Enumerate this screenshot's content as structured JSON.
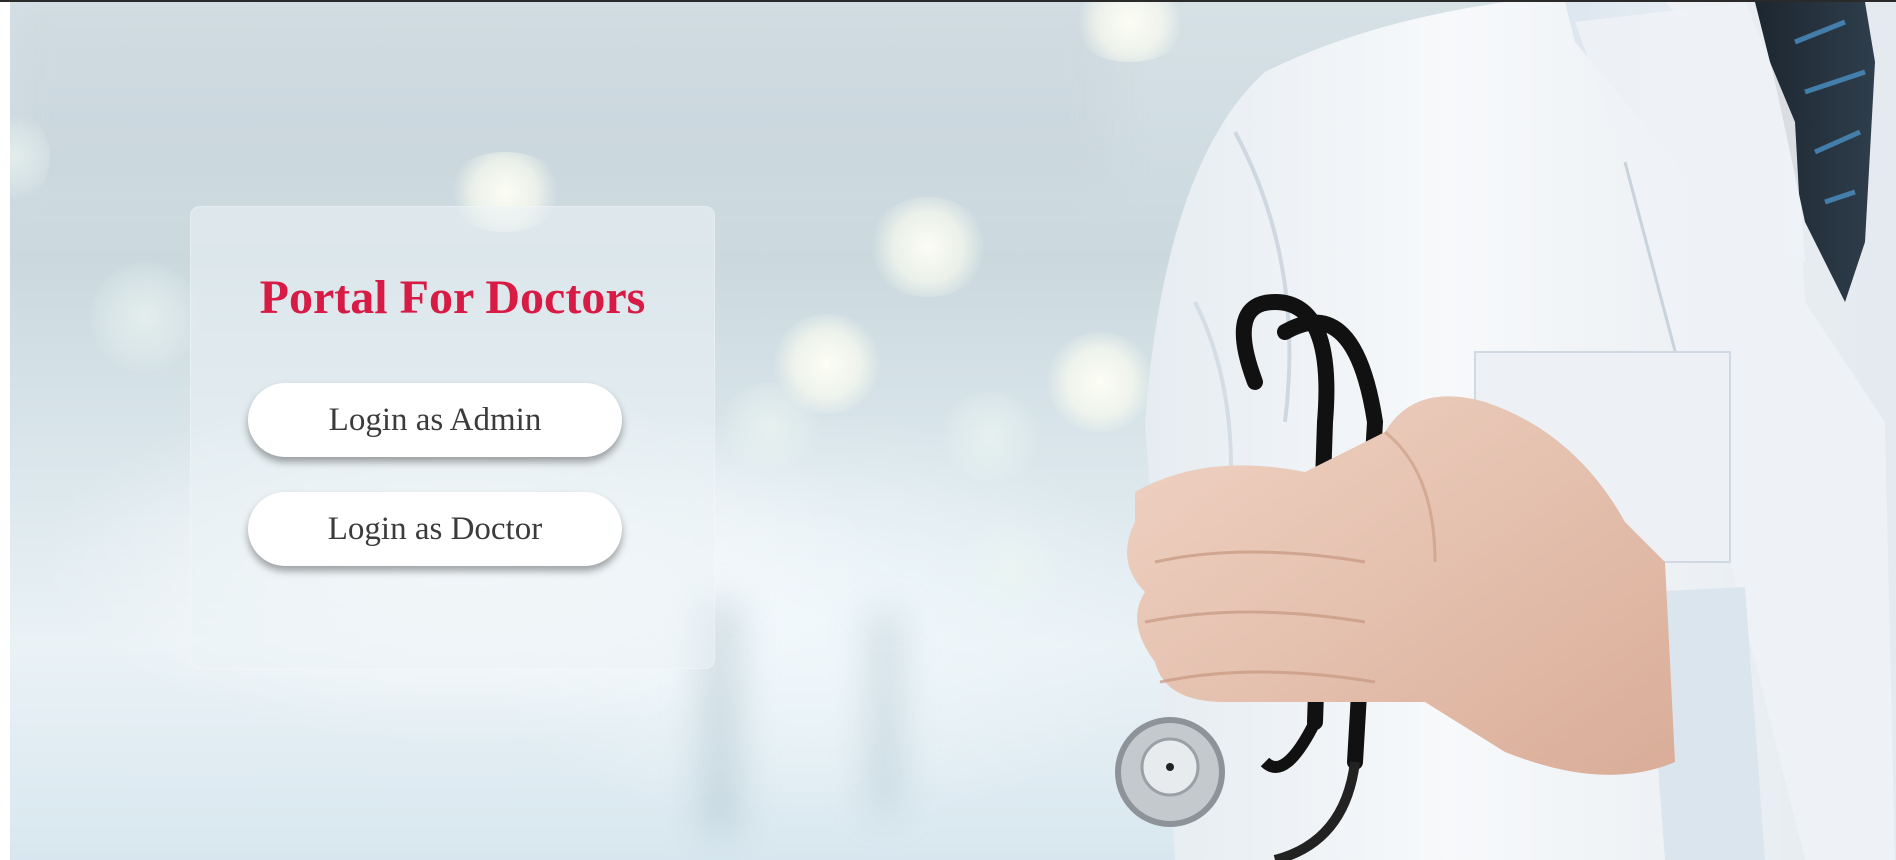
{
  "portal": {
    "title": "Portal For Doctors",
    "admin_login_label": "Login as Admin",
    "doctor_login_label": "Login as Doctor"
  },
  "colors": {
    "title": "#d81b45",
    "button_background": "#ffffff",
    "button_text": "#3b3b3b"
  }
}
